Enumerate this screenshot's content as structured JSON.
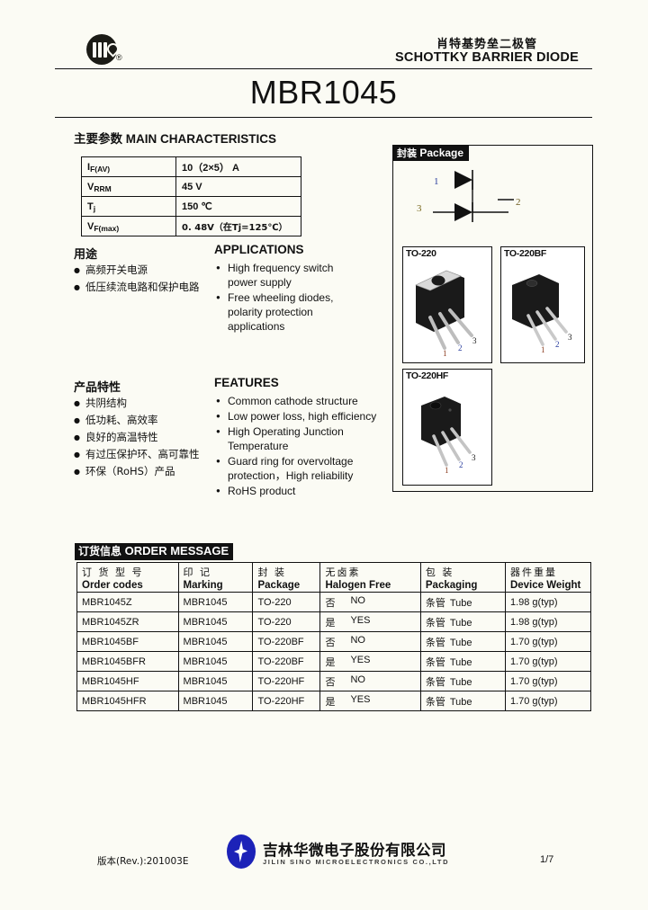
{
  "header": {
    "logo_alt": "JJJ",
    "title_cn": "肖特基势垒二极管",
    "title_en": "SCHOTTKY BARRIER DIODE",
    "part_number": "MBR1045"
  },
  "main_characteristics": {
    "title_cn": "主要参数",
    "title_en": "MAIN   CHARACTERISTICS",
    "rows": [
      {
        "symbol": "I",
        "sub": "F(AV)",
        "value": "10（2×5） A"
      },
      {
        "symbol": "V",
        "sub": "RRM",
        "value": "45 V"
      },
      {
        "symbol": "T",
        "sub": "j",
        "value": "150 ℃"
      },
      {
        "symbol": "V",
        "sub": "F(max)",
        "value": "0. 48V（在Tj=125℃）"
      }
    ]
  },
  "applications": {
    "title_cn": "用途",
    "title_en": "APPLICATIONS",
    "items_cn": [
      "高频开关电源",
      "低压续流电路和保护电路"
    ],
    "items_en": [
      {
        "line1": "High frequency switch",
        "line2": "power supply"
      },
      {
        "line1": "Free wheeling diodes,",
        "line2": "polarity protection",
        "line3": "applications"
      }
    ]
  },
  "features": {
    "title_cn": "产品特性",
    "title_en": "FEATURES",
    "items_cn": [
      "共阴结构",
      "低功耗、高效率",
      "良好的高温特性",
      "有过压保护环、高可靠性",
      "环保（RoHS）产品"
    ],
    "items_en": [
      {
        "line1": "Common cathode structure"
      },
      {
        "line1": "Low power loss, high efficiency"
      },
      {
        "line1": "High Operating Junction",
        "line2": "Temperature"
      },
      {
        "line1": "Guard ring for overvoltage",
        "line2": "protection，High reliability"
      },
      {
        "line1": "RoHS product"
      }
    ]
  },
  "package": {
    "banner_cn": "封装",
    "banner_en": "Package",
    "schematic_pins": {
      "pin1": "1",
      "pin2": "2",
      "pin3": "3"
    },
    "boxes": [
      {
        "caption": "TO-220"
      },
      {
        "caption": "TO-220BF"
      },
      {
        "caption": "TO-220HF"
      }
    ]
  },
  "order_message": {
    "banner_cn": "订货信息",
    "banner_en": "ORDER MESSAGE",
    "columns": [
      {
        "cn": "订 货 型 号",
        "en": "Order codes"
      },
      {
        "cn": "印    记",
        "en": "Marking"
      },
      {
        "cn": "封    装",
        "en": "Package"
      },
      {
        "cn": "无卤素",
        "en": "Halogen Free"
      },
      {
        "cn": "包    装",
        "en": "Packaging"
      },
      {
        "cn": "器件重量",
        "en": "Device Weight"
      }
    ],
    "rows": [
      {
        "code": "MBR1045Z",
        "marking": "MBR1045",
        "package": "TO-220",
        "halogen_cn": "否",
        "halogen_en": "NO",
        "packaging_cn": "条管",
        "packaging_en": "Tube",
        "weight": "1.98 g(typ)"
      },
      {
        "code": "MBR1045ZR",
        "marking": "MBR1045",
        "package": "TO-220",
        "halogen_cn": "是",
        "halogen_en": "YES",
        "packaging_cn": "条管",
        "packaging_en": "Tube",
        "weight": "1.98 g(typ)"
      },
      {
        "code": "MBR1045BF",
        "marking": "MBR1045",
        "package": "TO-220BF",
        "halogen_cn": "否",
        "halogen_en": "NO",
        "packaging_cn": "条管",
        "packaging_en": "Tube",
        "weight": "1.70 g(typ)"
      },
      {
        "code": "MBR1045BFR",
        "marking": "MBR1045",
        "package": "TO-220BF",
        "halogen_cn": "是",
        "halogen_en": "YES",
        "packaging_cn": "条管",
        "packaging_en": "Tube",
        "weight": "1.70 g(typ)"
      },
      {
        "code": "MBR1045HF",
        "marking": "MBR1045",
        "package": "TO-220HF",
        "halogen_cn": "否",
        "halogen_en": "NO",
        "packaging_cn": "条管",
        "packaging_en": "Tube",
        "weight": "1.70 g(typ)"
      },
      {
        "code": "MBR1045HFR",
        "marking": "MBR1045",
        "package": "TO-220HF",
        "halogen_cn": "是",
        "halogen_en": "YES",
        "packaging_cn": "条管",
        "packaging_en": "Tube",
        "weight": "1.70 g(typ)"
      }
    ]
  },
  "footer": {
    "revision": "版本(Rev.):201003E",
    "company_cn": "吉林华微电子股份有限公司",
    "company_en": "JILIN  SINO  MICROELECTRONICS  CO.,LTD",
    "page": "1/7"
  },
  "colors": {
    "ink": "#111111",
    "paper": "#fbfbf4",
    "logo_blue": "#1c22b8",
    "pin_blue": "#2b3f9e",
    "pin_gold": "#7a6a20"
  }
}
